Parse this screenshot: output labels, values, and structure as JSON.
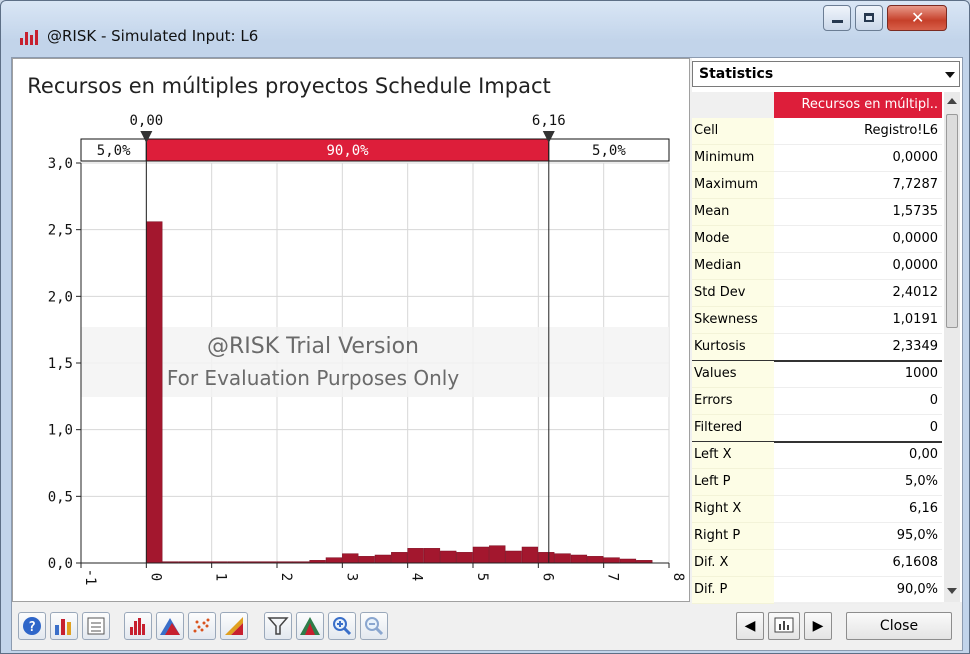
{
  "window": {
    "title": "@RISK - Simulated Input: L6"
  },
  "chart": {
    "title": "Recursos en múltiples proyectos Schedule Impact",
    "watermark_line1": "@RISK Trial Version",
    "watermark_line2": "For Evaluation Purposes Only",
    "left_marker_label": "0,00",
    "right_marker_label": "6,16",
    "band_left": "5,0%",
    "band_mid": "90,0%",
    "band_right": "5,0%",
    "colors": {
      "bar": "#a3172e",
      "band": "#dd1e3a",
      "grid": "#d7d7d7"
    }
  },
  "chart_data": {
    "type": "bar",
    "xlim": [
      -1,
      8
    ],
    "ylim": [
      0,
      3
    ],
    "x_ticks": [
      "-1",
      "0",
      "1",
      "2",
      "3",
      "4",
      "5",
      "6",
      "7",
      "8"
    ],
    "y_ticks": [
      "0,0",
      "0,5",
      "1,0",
      "1,5",
      "2,0",
      "2,5",
      "3,0"
    ],
    "bin_width": 0.25,
    "bins": [
      {
        "x": 0.0,
        "y": 2.56
      },
      {
        "x": 0.25,
        "y": 0.01
      },
      {
        "x": 0.5,
        "y": 0.01
      },
      {
        "x": 0.75,
        "y": 0.01
      },
      {
        "x": 1.0,
        "y": 0.01
      },
      {
        "x": 1.25,
        "y": 0.01
      },
      {
        "x": 1.5,
        "y": 0.01
      },
      {
        "x": 1.75,
        "y": 0.01
      },
      {
        "x": 2.0,
        "y": 0.01
      },
      {
        "x": 2.25,
        "y": 0.01
      },
      {
        "x": 2.5,
        "y": 0.02
      },
      {
        "x": 2.75,
        "y": 0.04
      },
      {
        "x": 3.0,
        "y": 0.07
      },
      {
        "x": 3.25,
        "y": 0.05
      },
      {
        "x": 3.5,
        "y": 0.06
      },
      {
        "x": 3.75,
        "y": 0.08
      },
      {
        "x": 4.0,
        "y": 0.11
      },
      {
        "x": 4.25,
        "y": 0.11
      },
      {
        "x": 4.5,
        "y": 0.09
      },
      {
        "x": 4.75,
        "y": 0.08
      },
      {
        "x": 5.0,
        "y": 0.12
      },
      {
        "x": 5.25,
        "y": 0.13
      },
      {
        "x": 5.5,
        "y": 0.09
      },
      {
        "x": 5.75,
        "y": 0.12
      },
      {
        "x": 6.0,
        "y": 0.08
      },
      {
        "x": 6.25,
        "y": 0.07
      },
      {
        "x": 6.5,
        "y": 0.06
      },
      {
        "x": 6.75,
        "y": 0.05
      },
      {
        "x": 7.0,
        "y": 0.04
      },
      {
        "x": 7.25,
        "y": 0.03
      },
      {
        "x": 7.5,
        "y": 0.02
      }
    ],
    "markers": {
      "left": 0.0,
      "right": 6.16
    }
  },
  "stats": {
    "dropdown_label": "Statistics",
    "column_header": "Recursos en múltipl..",
    "rows": [
      {
        "k": "Cell",
        "v": "Registro!L6"
      },
      {
        "k": "Minimum",
        "v": "0,0000"
      },
      {
        "k": "Maximum",
        "v": "7,7287"
      },
      {
        "k": "Mean",
        "v": "1,5735"
      },
      {
        "k": "Mode",
        "v": "0,0000"
      },
      {
        "k": "Median",
        "v": "0,0000"
      },
      {
        "k": "Std Dev",
        "v": "2,4012"
      },
      {
        "k": "Skewness",
        "v": "1,0191"
      },
      {
        "k": "Kurtosis",
        "v": "2,3349"
      },
      {
        "k": "Values",
        "v": "1000"
      },
      {
        "k": "Errors",
        "v": "0"
      },
      {
        "k": "Filtered",
        "v": "0"
      },
      {
        "k": "Left X",
        "v": "0,00"
      },
      {
        "k": "Left P",
        "v": "5,0%"
      },
      {
        "k": "Right X",
        "v": "6,16"
      },
      {
        "k": "Right P",
        "v": "95,0%"
      },
      {
        "k": "Dif. X",
        "v": "6,1608"
      },
      {
        "k": "Dif. P",
        "v": "90,0%"
      }
    ]
  },
  "toolbar": {
    "close_label": "Close",
    "prev_symbol": "◀",
    "next_symbol": "▶",
    "icons": [
      "help-icon",
      "histogram-type-icon",
      "report-icon",
      "histogram-icon",
      "area-chart-icon",
      "scatter-icon",
      "overlay-icon",
      "filter-icon",
      "distribution-fit-icon",
      "zoom-in-icon",
      "zoom-out-icon"
    ]
  }
}
